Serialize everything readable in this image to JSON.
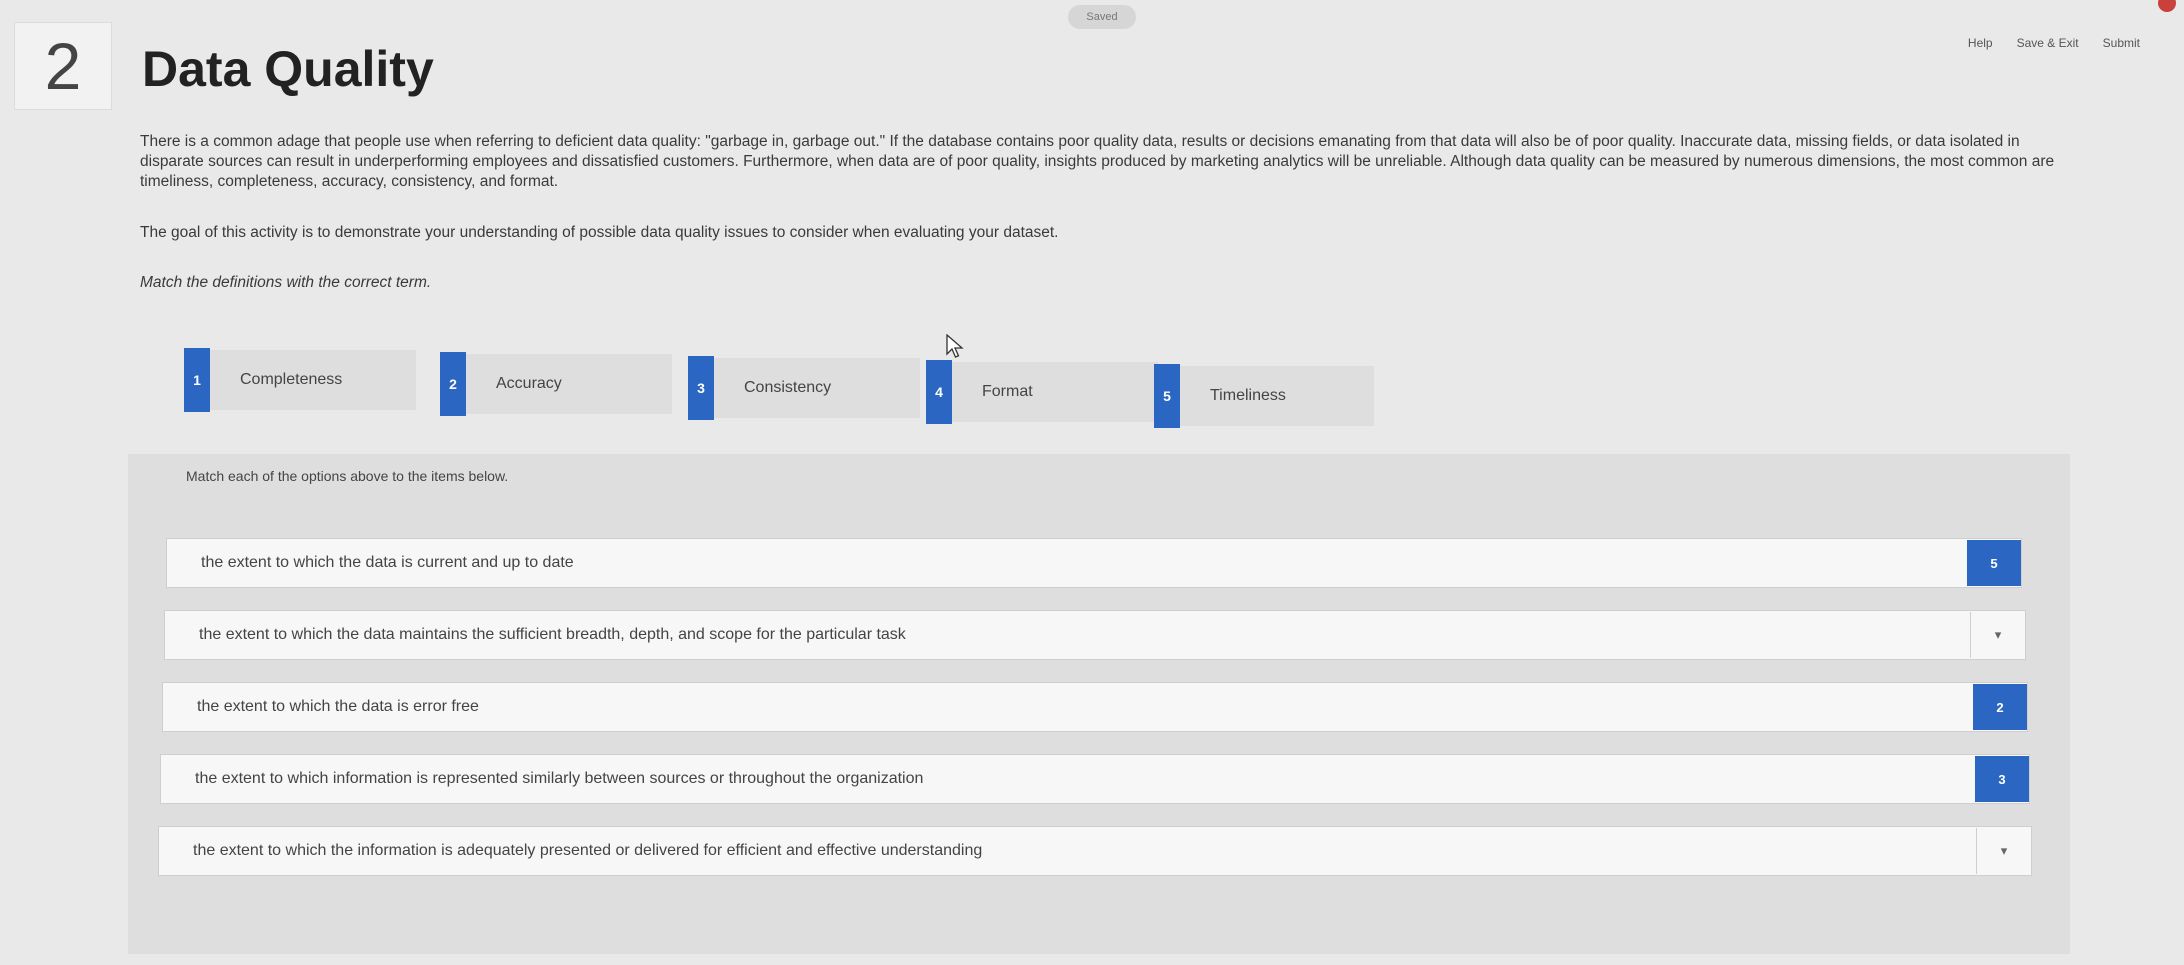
{
  "header": {
    "saved_label": "Saved",
    "links": [
      "Help",
      "Save & Exit",
      "Submit"
    ]
  },
  "question": {
    "number": "2",
    "title": "Data Quality",
    "intro": "There is a common adage that people use when referring to deficient data quality: \"garbage in, garbage out.\" If the database contains poor quality data, results or decisions emanating from that data will also be of poor quality. Inaccurate data, missing fields, or data isolated in disparate sources can result in underperforming employees and dissatisfied customers. Furthermore, when data are of poor quality, insights produced by marketing analytics will be unreliable. Although data quality can be measured by numerous dimensions, the most common are timeliness, completeness, accuracy, consistency, and format.",
    "goal": "The goal of this activity is to demonstrate your understanding of possible data quality issues to consider when evaluating your dataset.",
    "instruction": "Match the definitions with the correct term."
  },
  "options": [
    {
      "num": "1",
      "label": "Completeness"
    },
    {
      "num": "2",
      "label": "Accuracy"
    },
    {
      "num": "3",
      "label": "Consistency"
    },
    {
      "num": "4",
      "label": "Format"
    },
    {
      "num": "5",
      "label": "Timeliness"
    }
  ],
  "panel": {
    "note": "Match each of the options above to the items below."
  },
  "items": [
    {
      "text": "the extent to which the data is current and up to date",
      "answer": "5"
    },
    {
      "text": "the extent to which the data maintains the sufficient breadth, depth, and scope for the particular task",
      "answer": "▾"
    },
    {
      "text": "the extent to which the data is error free",
      "answer": "2"
    },
    {
      "text": "the extent to which information is represented similarly between sources or throughout the organization",
      "answer": "3"
    },
    {
      "text": "the extent to which the information is adequately presented or delivered for efficient and effective understanding",
      "answer": "▾"
    }
  ],
  "colors": {
    "accent": "#2a66c2",
    "background": "#e9e9e9"
  }
}
